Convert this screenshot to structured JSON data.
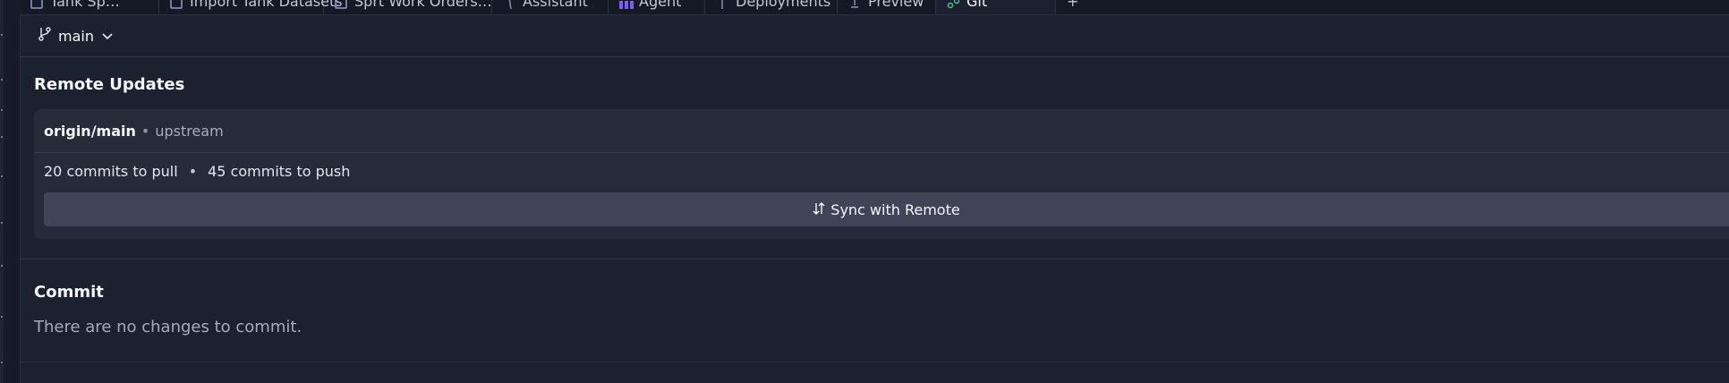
{
  "tabs": [
    {
      "label": "Tank Sp…"
    },
    {
      "label": "Import Tank Datasets"
    },
    {
      "label": "Sprt Work Orders…"
    },
    {
      "label": "Assistant"
    },
    {
      "label": "Agent"
    },
    {
      "label": "Deployments"
    },
    {
      "label": "Preview"
    },
    {
      "label": "Git"
    },
    {
      "label": "+"
    }
  ],
  "branch": {
    "name": "main",
    "icon": "git-branch-icon"
  },
  "remote_updates": {
    "title": "Remote Updates",
    "remote_name": "origin/main",
    "separator": "•",
    "remote_kind": "upstream",
    "pull_text": "20 commits to pull",
    "stats_separator": "•",
    "push_text": "45 commits to push",
    "sync_label": "Sync with Remote"
  },
  "commit": {
    "title": "Commit",
    "empty_text": "There are no changes to commit."
  },
  "colors": {
    "background": "#1c2130",
    "card": "#262b3a",
    "button": "#3f4457",
    "agent_icon": "#7b5cff",
    "git_icon": "#4cc38a"
  }
}
